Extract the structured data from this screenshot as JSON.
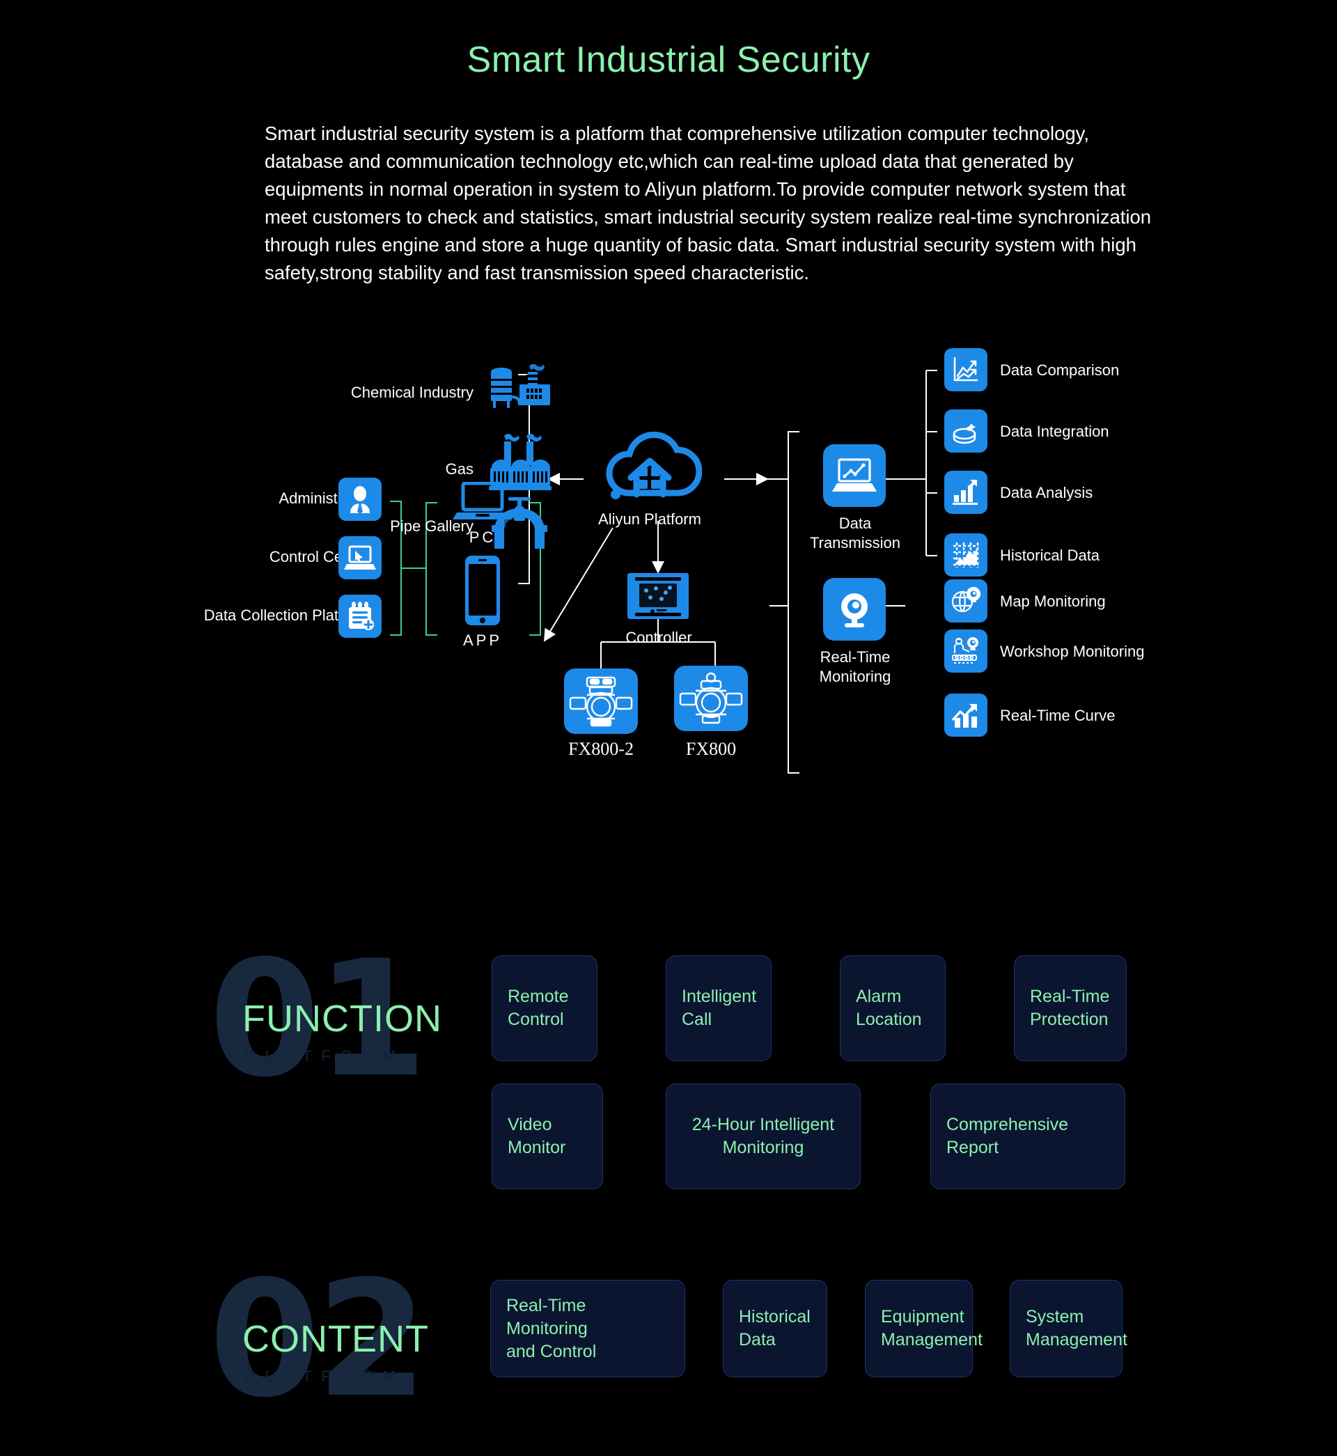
{
  "header": {
    "title": "Smart Industrial Security",
    "intro": "Smart industrial security system is a platform that comprehensive utilization computer technology, database and communication technology etc,which can real-time upload data that generated by equipments in normal operation in system to Aliyun platform.To provide computer network system that meet customers to check and statistics, smart industrial security system realize real-time synchronization through rules engine and store a huge quantity of basic data. Smart industrial security system with high safety,strong stability and fast transmission speed characteristic."
  },
  "colors": {
    "accent_green": "#8cf0ae",
    "icon_blue": "#1e8ae8",
    "card_bg": "#0b1530",
    "card_border": "#1b3570",
    "watermark": "#18293f",
    "background": "#000000"
  },
  "diagram": {
    "sources": [
      {
        "label": "Chemical Industry",
        "icon": "factory-icon"
      },
      {
        "label": "Gas",
        "icon": "gas-plant-icon"
      },
      {
        "label": "Pipe Gallery",
        "icon": "pipe-valve-icon"
      }
    ],
    "platform": {
      "label": "Aliyun Platform",
      "icon": "cloud-home-icon"
    },
    "transmission": {
      "label": "Data\nTransmission",
      "icon": "laptop-chart-icon"
    },
    "data_outputs": [
      {
        "label": "Data Comparison",
        "icon": "line-chart-compare-icon"
      },
      {
        "label": "Data Integration",
        "icon": "pie-database-icon"
      },
      {
        "label": "Data Analysis",
        "icon": "bar-chart-arrow-icon"
      },
      {
        "label": "Historical Data",
        "icon": "history-graph-icon"
      }
    ],
    "monitoring": {
      "label": "Real-Time\nMonitoring",
      "icon": "webcam-icon"
    },
    "monitor_outputs": [
      {
        "label": "Map Monitoring",
        "icon": "globe-camera-icon"
      },
      {
        "label": "Workshop Monitoring",
        "icon": "conveyor-camera-icon"
      },
      {
        "label": "Real-Time Curve",
        "icon": "curve-bar-icon"
      }
    ],
    "users": [
      {
        "label": "Administrator",
        "icon": "user-tie-icon"
      },
      {
        "label": "Control Center",
        "icon": "laptop-cursor-icon"
      },
      {
        "label": "Data Collection Platform",
        "icon": "clipboard-add-icon"
      }
    ],
    "clients": [
      {
        "label": "PC",
        "icon": "laptop-icon"
      },
      {
        "label": "APP",
        "icon": "smartphone-icon"
      }
    ],
    "controller": {
      "label": "Controller",
      "icon": "controller-panel-icon"
    },
    "devices": [
      {
        "label": "FX800-2",
        "icon": "gas-detector-2-icon"
      },
      {
        "label": "FX800",
        "icon": "gas-detector-icon"
      }
    ]
  },
  "sections": [
    {
      "number": "01",
      "title": "FUNCTION",
      "subtitle": "PLATFORM",
      "cards_row1": [
        {
          "label": "Remote\nControl"
        },
        {
          "label": "Intelligent\nCall"
        },
        {
          "label": "Alarm\nLocation"
        },
        {
          "label": "Real-Time\nProtection"
        }
      ],
      "cards_row2": [
        {
          "label": "Video\nMonitor"
        },
        {
          "label": "24-Hour Intelligent\nMonitoring"
        },
        {
          "label": "Comprehensive\nReport"
        }
      ]
    },
    {
      "number": "02",
      "title": "CONTENT",
      "subtitle": "PLATFORM",
      "cards_row1": [
        {
          "label": "Real-Time Monitoring\nand Control"
        },
        {
          "label": "Historical\nData"
        },
        {
          "label": "Equipment\nManagement"
        },
        {
          "label": "System\nManagement"
        }
      ],
      "cards_row2": []
    }
  ]
}
